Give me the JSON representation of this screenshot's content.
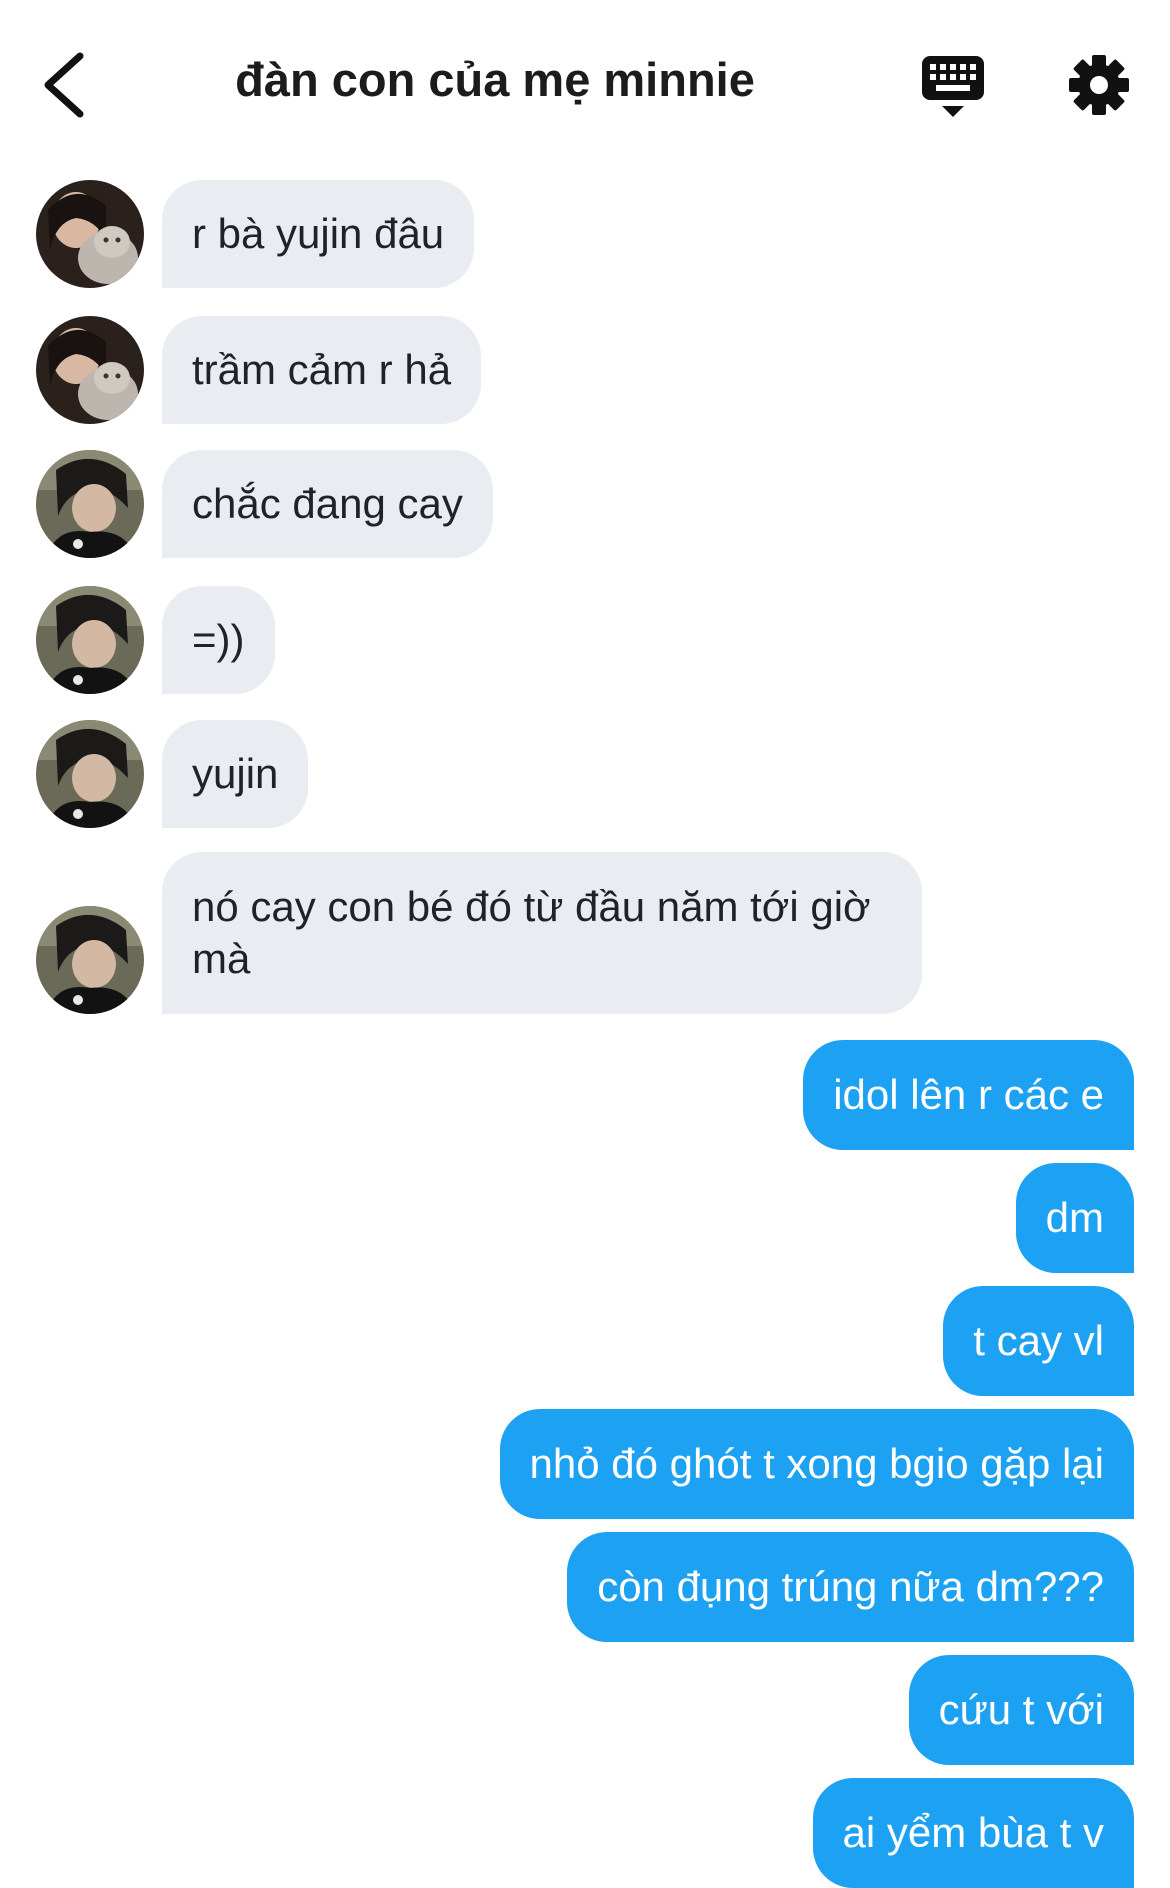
{
  "header": {
    "title": "đàn con của mẹ minnie",
    "back_icon": "chevron-left-icon",
    "keyboard_icon": "keyboard-icon",
    "settings_icon": "gear-icon"
  },
  "colors": {
    "incoming_bubble": "#e9edf1",
    "outgoing_bubble": "#1da1f2",
    "incoming_text": "#1d2329",
    "outgoing_text": "#ffffff"
  },
  "messages": [
    {
      "direction": "in",
      "sender": "girl-with-cat",
      "text": "r bà yujin đâu"
    },
    {
      "direction": "in",
      "sender": "girl-with-cat",
      "text": "trầm cảm r hả"
    },
    {
      "direction": "in",
      "sender": "boy-selfie",
      "text": "chắc đang cay"
    },
    {
      "direction": "in",
      "sender": "boy-selfie",
      "text": "=))"
    },
    {
      "direction": "in",
      "sender": "boy-selfie",
      "text": "yujin"
    },
    {
      "direction": "in",
      "sender": "boy-selfie",
      "text": "nó cay con bé đó từ đầu năm tới giờ mà"
    },
    {
      "direction": "out",
      "text": "idol lên r các e"
    },
    {
      "direction": "out",
      "text": "dm"
    },
    {
      "direction": "out",
      "text": "t cay vl"
    },
    {
      "direction": "out",
      "text": "nhỏ đó ghót t xong bgio gặp lại"
    },
    {
      "direction": "out",
      "text": "còn đụng trúng nữa dm???"
    },
    {
      "direction": "out",
      "text": "cứu t với"
    },
    {
      "direction": "out",
      "text": "ai yểm bùa t v"
    }
  ]
}
